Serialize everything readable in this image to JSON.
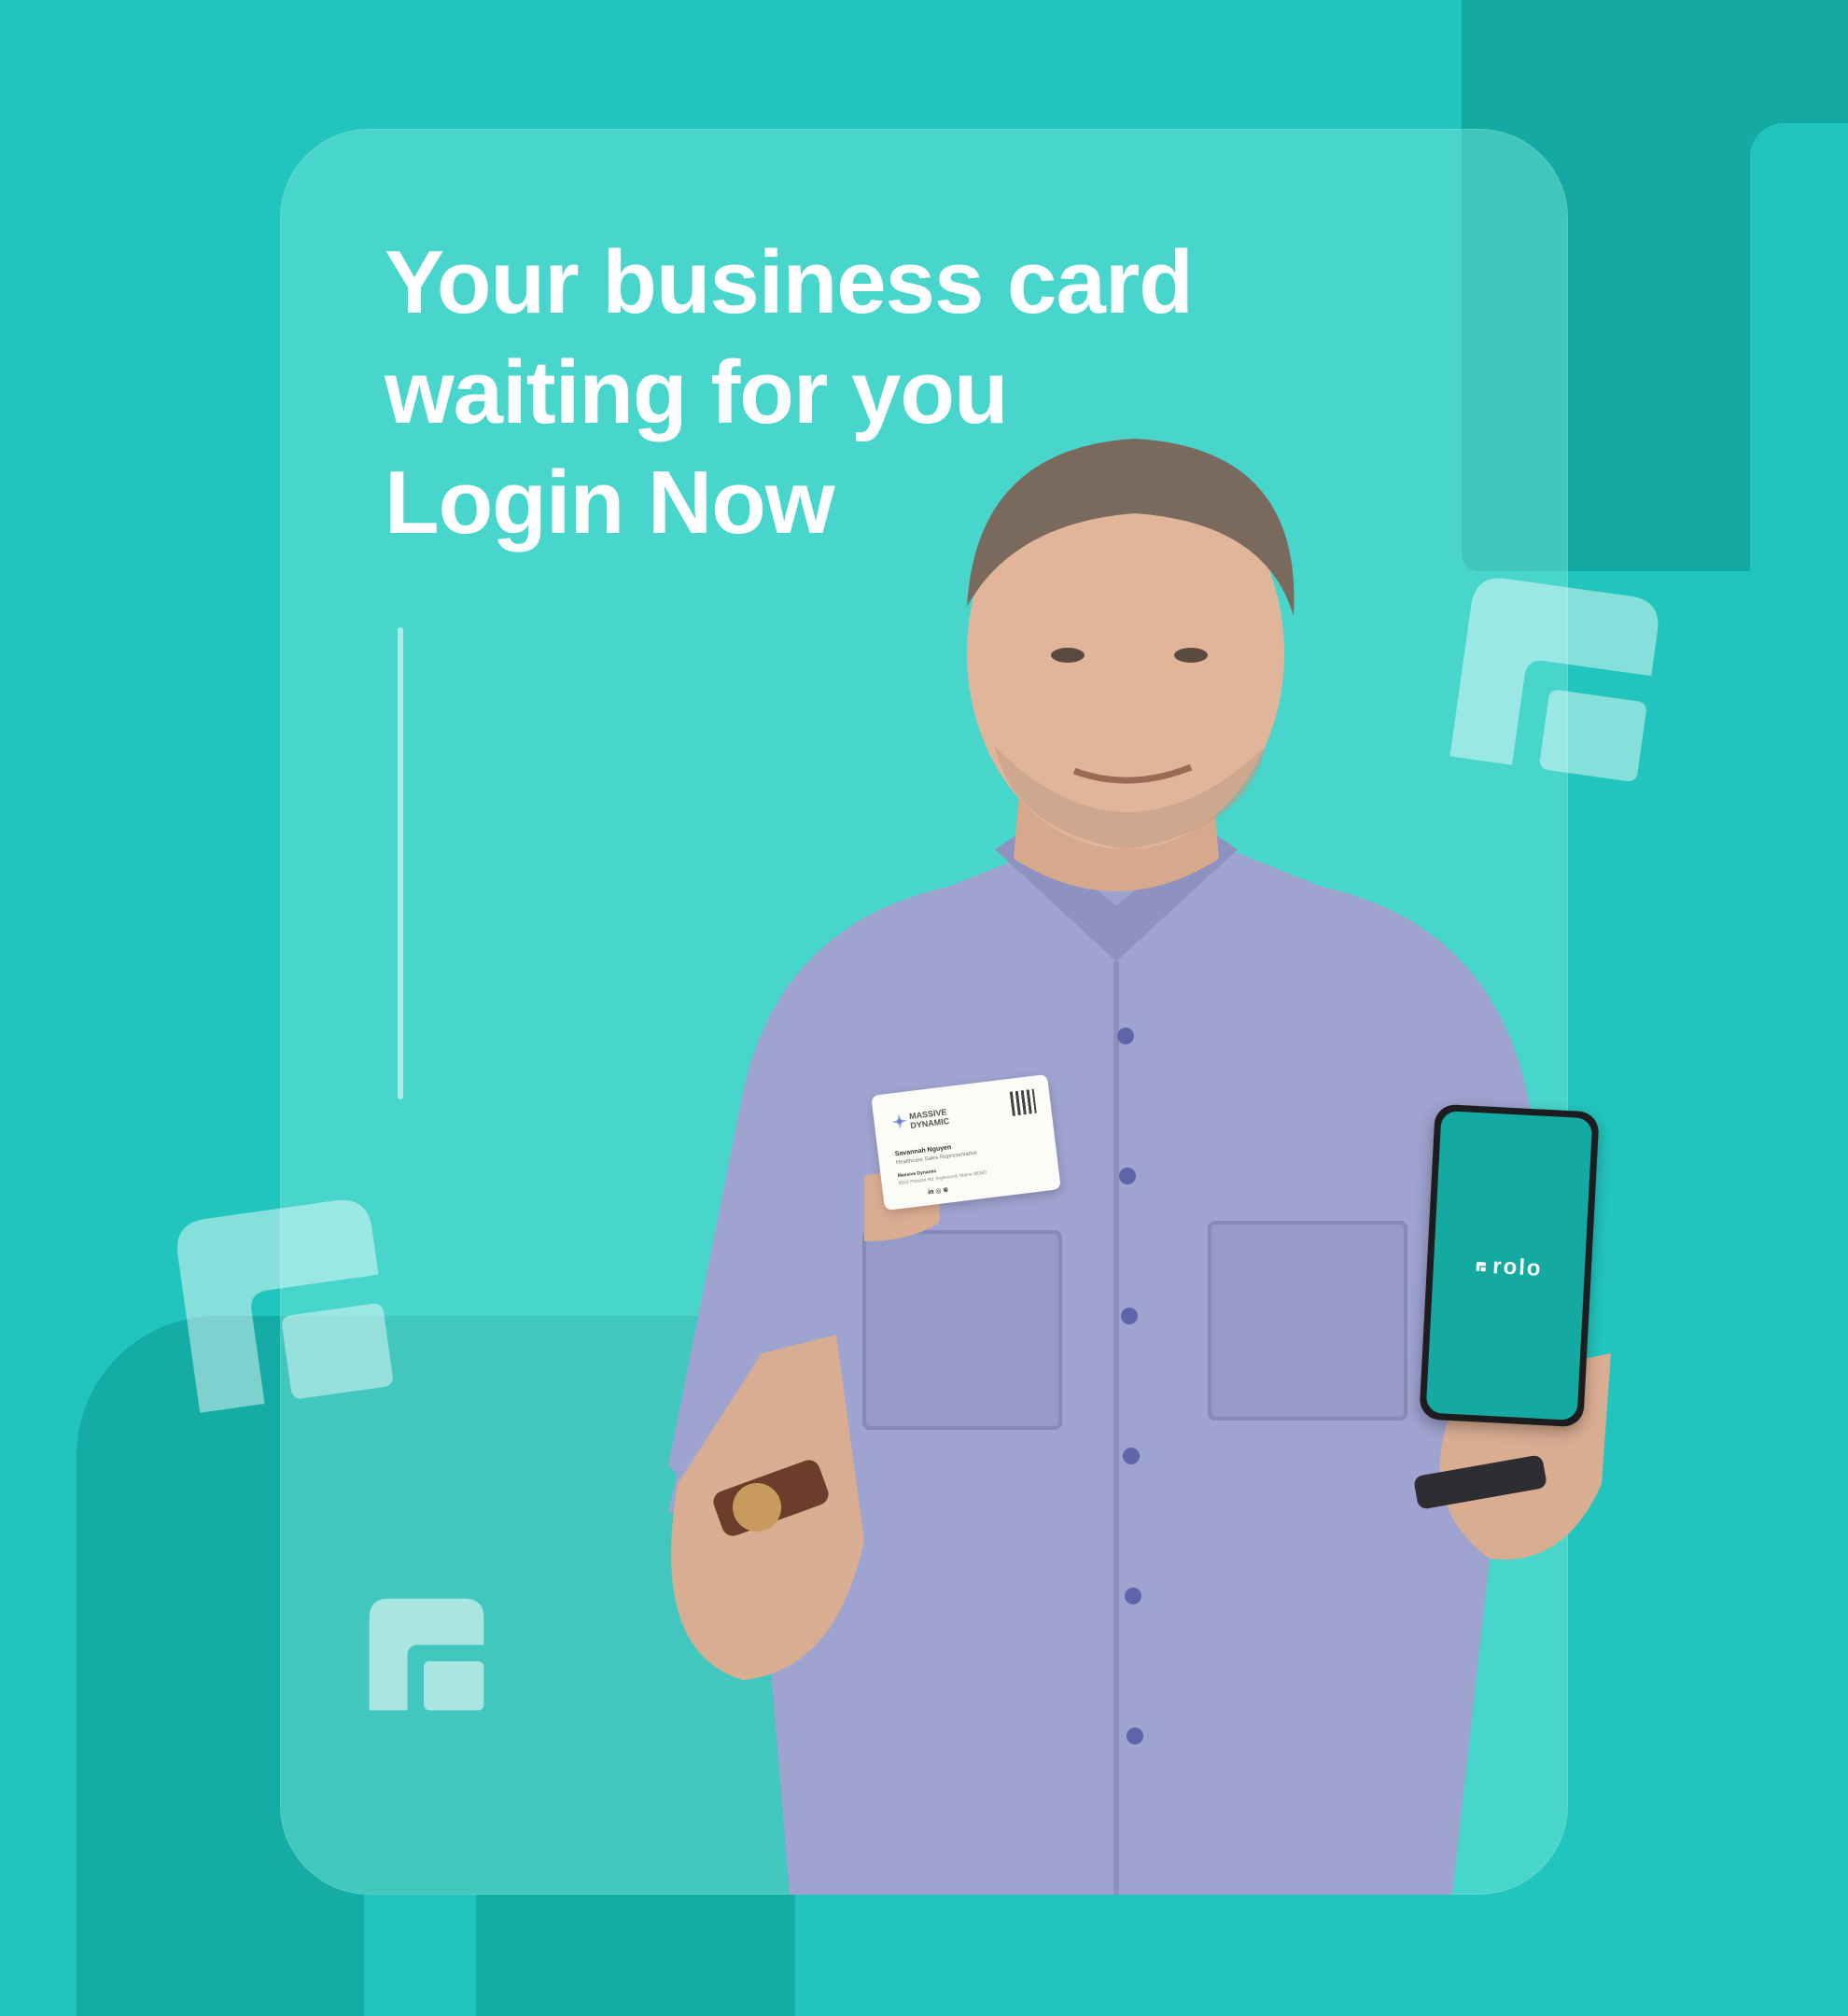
{
  "headline": {
    "line1": "Your business card",
    "line2": "waiting for you",
    "line3": "Login Now"
  },
  "business_card": {
    "brand": "MASSIVE DYNAMIC",
    "name": "Savannah Nguyen",
    "title": "Healthcare Sales Representative",
    "company": "Massive Dynamic",
    "address": "8502 Preston Rd. Inglewood, Maine 98380",
    "social": "in ◎ ⊗"
  },
  "phone": {
    "brand": "rolo"
  },
  "colors": {
    "background": "#22c5bd",
    "accent_dark": "#14aaa3",
    "panel": "#78e8de",
    "text": "#ffffff"
  },
  "icons": [
    "rolo-logo-icon"
  ]
}
